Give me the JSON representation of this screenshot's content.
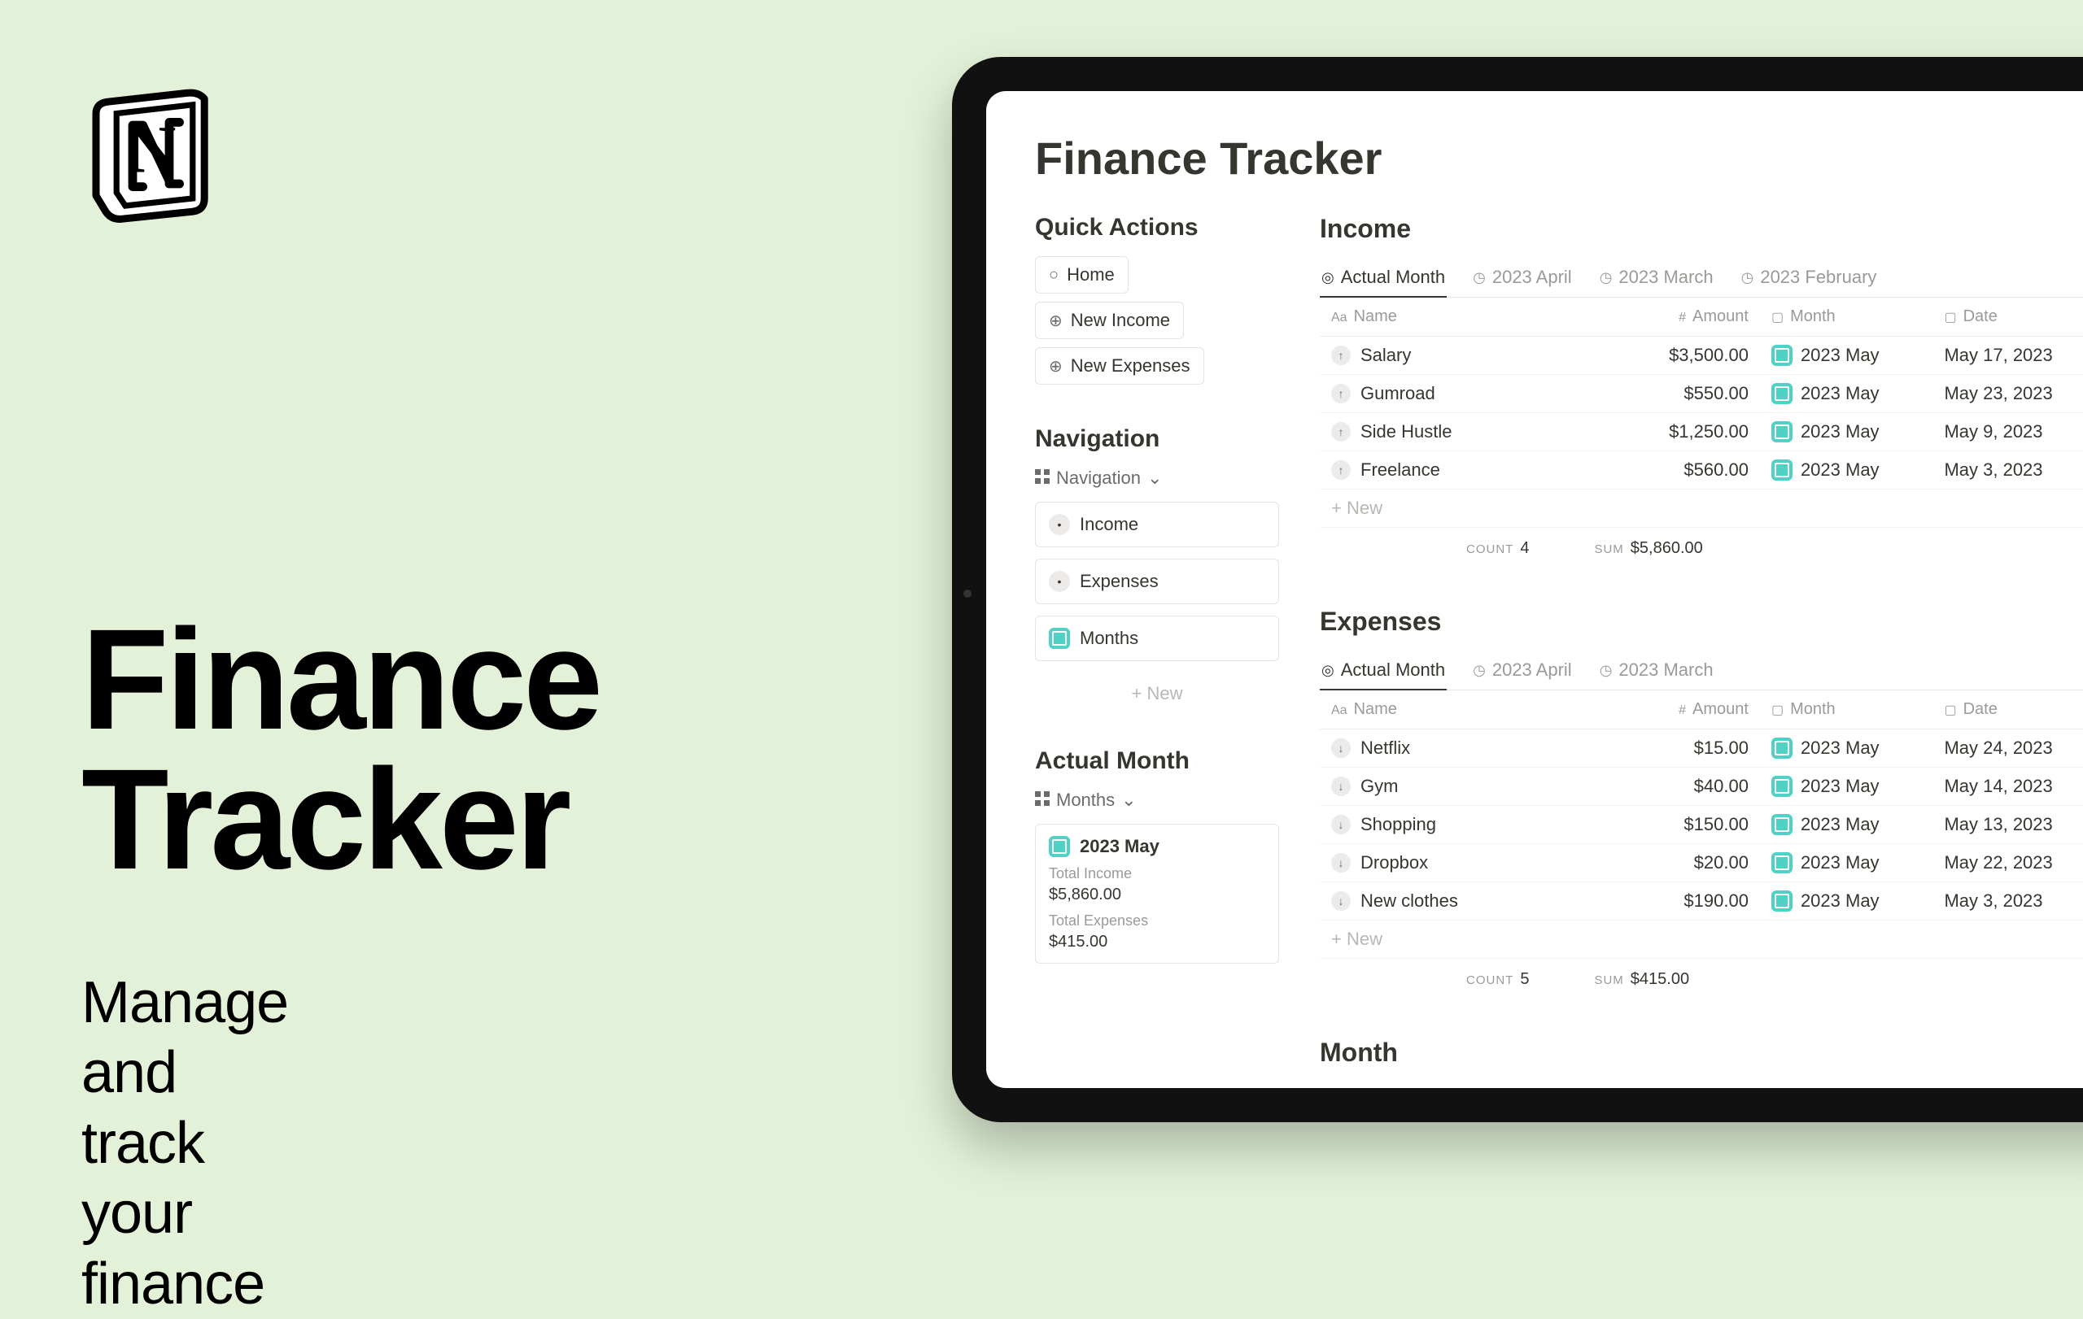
{
  "promo": {
    "title_line1": "Finance",
    "title_line2": "Tracker",
    "subtitle_line1": "Manage and track",
    "subtitle_line2": "your finance"
  },
  "app": {
    "page_title": "Finance Tracker",
    "quick_actions": {
      "heading": "Quick Actions",
      "items": [
        {
          "label": "Home",
          "icon": "○"
        },
        {
          "label": "New Income",
          "icon": "⊕"
        },
        {
          "label": "New Expenses",
          "icon": "⊕"
        }
      ]
    },
    "navigation": {
      "heading": "Navigation",
      "selector_label": "Navigation",
      "items": [
        {
          "label": "Income"
        },
        {
          "label": "Expenses"
        },
        {
          "label": "Months",
          "teal": true
        }
      ],
      "new_label": "+   New"
    },
    "actual_month": {
      "heading": "Actual Month",
      "selector_label": "Months",
      "card_title": "2023 May",
      "total_income_label": "Total Income",
      "total_income_value": "$5,860.00",
      "total_expenses_label": "Total Expenses",
      "total_expenses_value": "$415.00"
    },
    "income": {
      "heading": "Income",
      "tabs": [
        "Actual Month",
        "2023 April",
        "2023 March",
        "2023 February"
      ],
      "columns": {
        "name": "Name",
        "amount": "Amount",
        "month": "Month",
        "date": "Date"
      },
      "rows": [
        {
          "name": "Salary",
          "amount": "$3,500.00",
          "month": "2023 May",
          "date": "May 17, 2023"
        },
        {
          "name": "Gumroad",
          "amount": "$550.00",
          "month": "2023 May",
          "date": "May 23, 2023"
        },
        {
          "name": "Side Hustle",
          "amount": "$1,250.00",
          "month": "2023 May",
          "date": "May 9, 2023"
        },
        {
          "name": "Freelance",
          "amount": "$560.00",
          "month": "2023 May",
          "date": "May 3, 2023"
        }
      ],
      "new_label": "+  New",
      "count_label": "COUNT",
      "count_value": "4",
      "sum_label": "SUM",
      "sum_value": "$5,860.00"
    },
    "expenses": {
      "heading": "Expenses",
      "tabs": [
        "Actual Month",
        "2023 April",
        "2023 March"
      ],
      "columns": {
        "name": "Name",
        "amount": "Amount",
        "month": "Month",
        "date": "Date"
      },
      "rows": [
        {
          "name": "Netflix",
          "amount": "$15.00",
          "month": "2023 May",
          "date": "May 24, 2023"
        },
        {
          "name": "Gym",
          "amount": "$40.00",
          "month": "2023 May",
          "date": "May 14, 2023"
        },
        {
          "name": "Shopping",
          "amount": "$150.00",
          "month": "2023 May",
          "date": "May 13, 2023"
        },
        {
          "name": "Dropbox",
          "amount": "$20.00",
          "month": "2023 May",
          "date": "May 22, 2023"
        },
        {
          "name": "New clothes",
          "amount": "$190.00",
          "month": "2023 May",
          "date": "May 3, 2023"
        }
      ],
      "new_label": "+  New",
      "count_label": "COUNT",
      "count_value": "5",
      "sum_label": "SUM",
      "sum_value": "$415.00"
    },
    "months_heading": "Month"
  }
}
